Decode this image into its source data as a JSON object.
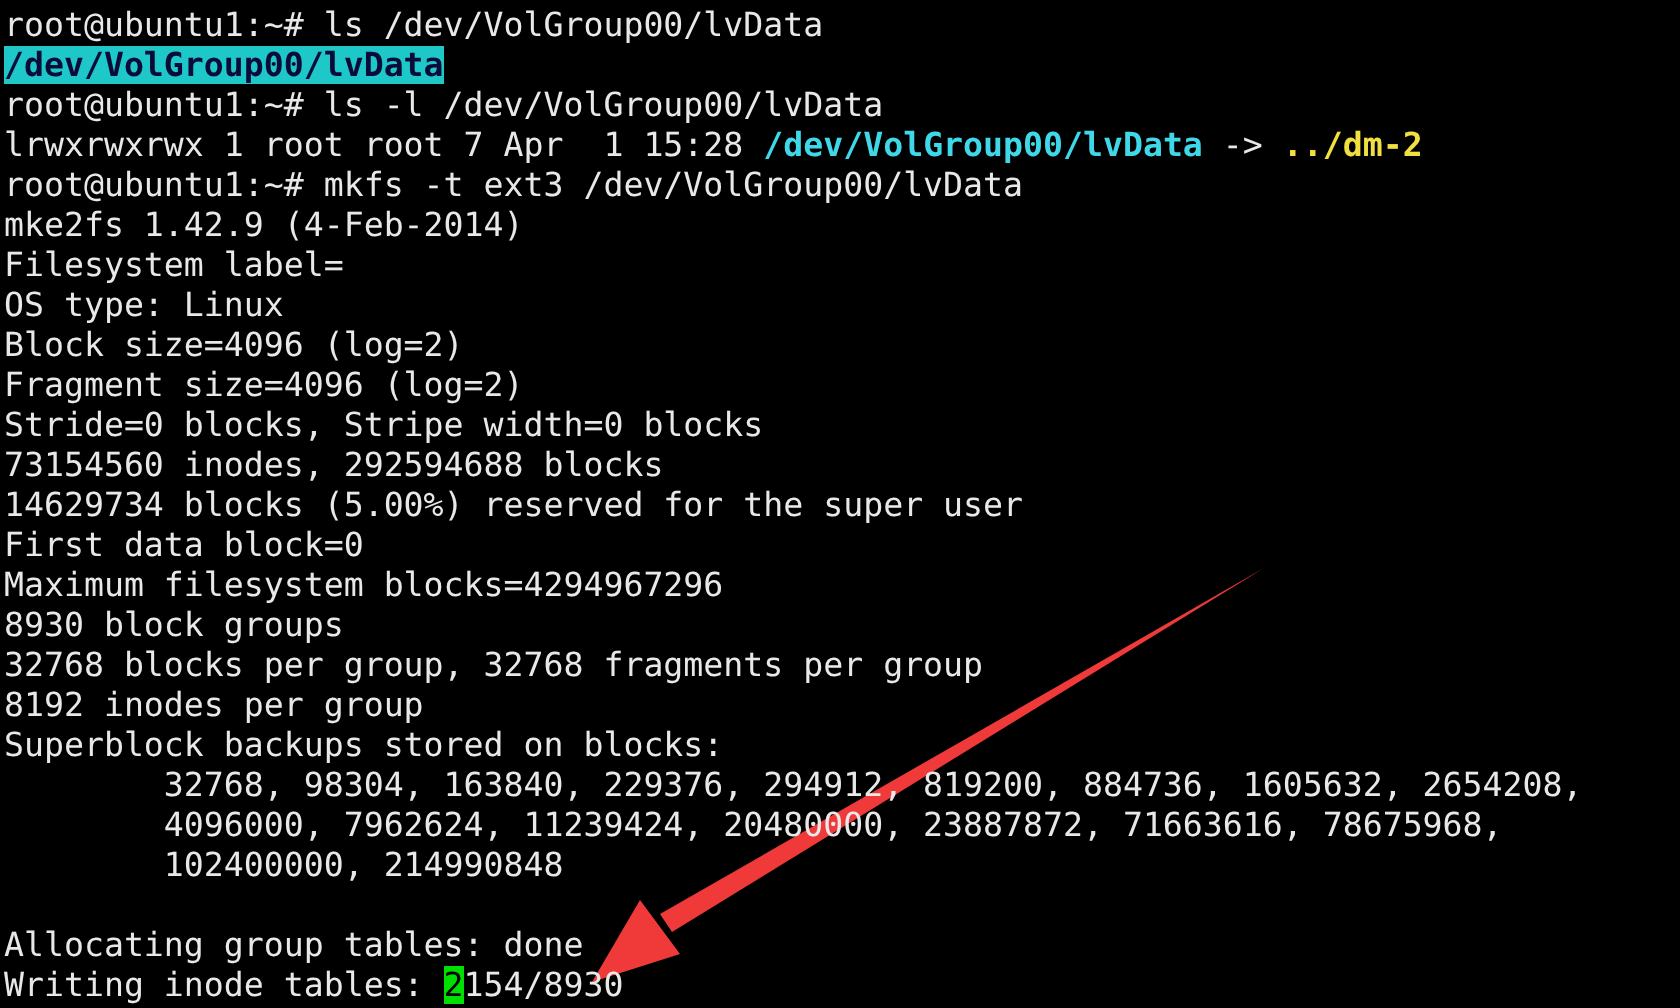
{
  "terminal": {
    "lines": [
      {
        "kind": "text",
        "segments": [
          {
            "kind": "plain",
            "text": "root@ubuntu1:~# ls /dev/VolGroup00/lvData"
          }
        ]
      },
      {
        "kind": "text",
        "segments": [
          {
            "kind": "highlight",
            "text": "/dev/VolGroup00/lvData"
          }
        ]
      },
      {
        "kind": "text",
        "segments": [
          {
            "kind": "plain",
            "text": "root@ubuntu1:~# ls -l /dev/VolGroup00/lvData"
          }
        ]
      },
      {
        "kind": "text",
        "segments": [
          {
            "kind": "plain",
            "text": "lrwxrwxrwx 1 root root 7 Apr  1 15:28 "
          },
          {
            "kind": "dir",
            "text": "/dev/VolGroup00/lvData"
          },
          {
            "kind": "plain",
            "text": " -> "
          },
          {
            "kind": "target",
            "text": "../dm-2"
          }
        ]
      },
      {
        "kind": "text",
        "segments": [
          {
            "kind": "plain",
            "text": "root@ubuntu1:~# mkfs -t ext3 /dev/VolGroup00/lvData"
          }
        ]
      },
      {
        "kind": "text",
        "segments": [
          {
            "kind": "plain",
            "text": "mke2fs 1.42.9 (4-Feb-2014)"
          }
        ]
      },
      {
        "kind": "text",
        "segments": [
          {
            "kind": "plain",
            "text": "Filesystem label="
          }
        ]
      },
      {
        "kind": "text",
        "segments": [
          {
            "kind": "plain",
            "text": "OS type: Linux"
          }
        ]
      },
      {
        "kind": "text",
        "segments": [
          {
            "kind": "plain",
            "text": "Block size=4096 (log=2)"
          }
        ]
      },
      {
        "kind": "text",
        "segments": [
          {
            "kind": "plain",
            "text": "Fragment size=4096 (log=2)"
          }
        ]
      },
      {
        "kind": "text",
        "segments": [
          {
            "kind": "plain",
            "text": "Stride=0 blocks, Stripe width=0 blocks"
          }
        ]
      },
      {
        "kind": "text",
        "segments": [
          {
            "kind": "plain",
            "text": "73154560 inodes, 292594688 blocks"
          }
        ]
      },
      {
        "kind": "text",
        "segments": [
          {
            "kind": "plain",
            "text": "14629734 blocks (5.00%) reserved for the super user"
          }
        ]
      },
      {
        "kind": "text",
        "segments": [
          {
            "kind": "plain",
            "text": "First data block=0"
          }
        ]
      },
      {
        "kind": "text",
        "segments": [
          {
            "kind": "plain",
            "text": "Maximum filesystem blocks=4294967296"
          }
        ]
      },
      {
        "kind": "text",
        "segments": [
          {
            "kind": "plain",
            "text": "8930 block groups"
          }
        ]
      },
      {
        "kind": "text",
        "segments": [
          {
            "kind": "plain",
            "text": "32768 blocks per group, 32768 fragments per group"
          }
        ]
      },
      {
        "kind": "text",
        "segments": [
          {
            "kind": "plain",
            "text": "8192 inodes per group"
          }
        ]
      },
      {
        "kind": "text",
        "segments": [
          {
            "kind": "plain",
            "text": "Superblock backups stored on blocks:"
          }
        ]
      },
      {
        "kind": "text",
        "segments": [
          {
            "kind": "plain",
            "text": "        32768, 98304, 163840, 229376, 294912, 819200, 884736, 1605632, 2654208,"
          }
        ]
      },
      {
        "kind": "text",
        "segments": [
          {
            "kind": "plain",
            "text": "        4096000, 7962624, 11239424, 20480000, 23887872, 71663616, 78675968,"
          }
        ]
      },
      {
        "kind": "text",
        "segments": [
          {
            "kind": "plain",
            "text": "        102400000, 214990848"
          }
        ]
      },
      {
        "kind": "blank"
      },
      {
        "kind": "text",
        "segments": [
          {
            "kind": "plain",
            "text": "Allocating group tables: done"
          }
        ]
      },
      {
        "kind": "text",
        "segments": [
          {
            "kind": "plain",
            "text": "Writing inode tables: "
          },
          {
            "kind": "cursor",
            "text": "2"
          },
          {
            "kind": "plain",
            "text": "154/8930"
          }
        ]
      }
    ]
  }
}
